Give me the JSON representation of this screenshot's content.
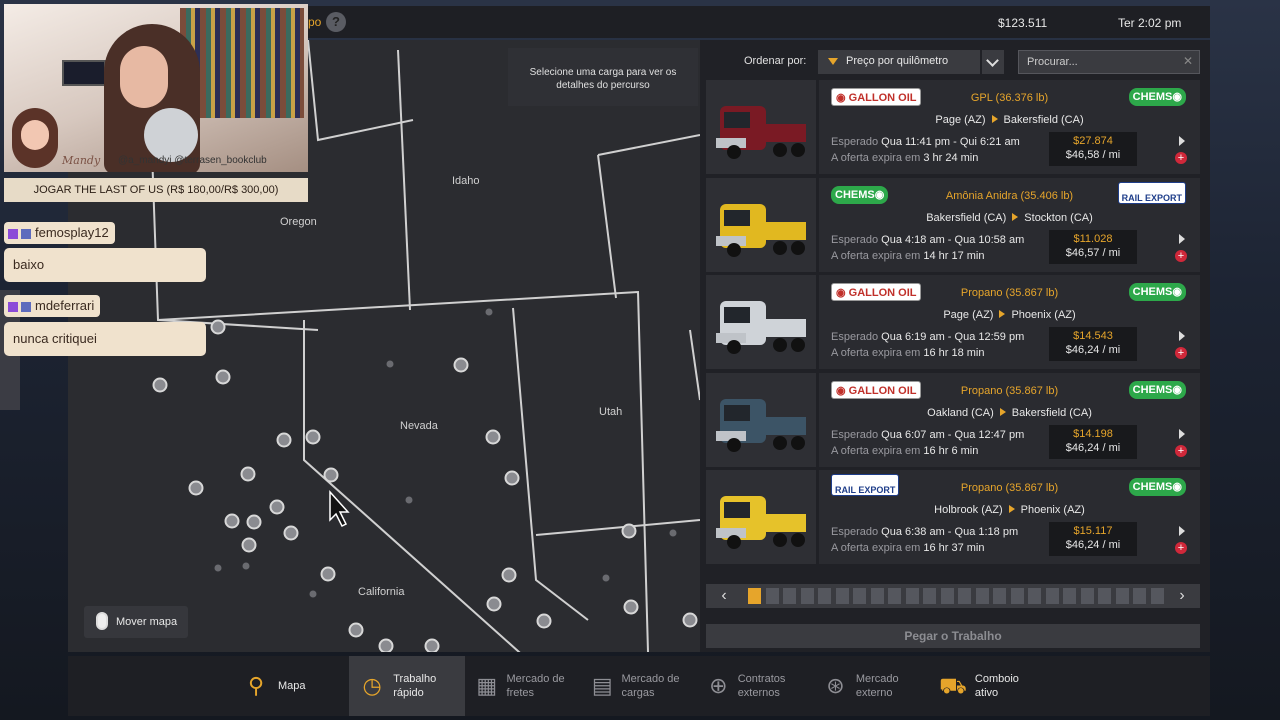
{
  "topbar": {
    "tab_stub": "po",
    "help_icon": "?",
    "money": "$123.511",
    "clock": "Ter 2:02 pm"
  },
  "map": {
    "hint": "Selecione uma carga para ver os detalhes do percurso",
    "states": {
      "oregon": "Oregon",
      "idaho": "Idaho",
      "nevada": "Nevada",
      "utah": "Utah",
      "california": "California"
    },
    "move_button": "Mover mapa"
  },
  "jobs_panel": {
    "sort_label": "Ordenar por:",
    "sort_value": "Preço por quilômetro",
    "search_placeholder": "Procurar...",
    "expected_label": "Esperado",
    "offer_label": "A oferta expira em",
    "jobs": [
      {
        "from_logo": "GALLON OIL",
        "to_logo": "CHEMSO",
        "cargo": "GPL (36.376 lb)",
        "origin": "Page (AZ)",
        "destination": "Bakersfield (CA)",
        "expected": "Qua 11:41 pm - Qui 6:21 am",
        "expires": "3 hr 24 min",
        "price": "$27.874",
        "per_mile": "$46,58 / mi",
        "truck_color": "#7a1a24"
      },
      {
        "from_logo": "CHEMSO",
        "to_logo": "RAIL EXPORT",
        "cargo": "Amônia Anidra (35.406 lb)",
        "origin": "Bakersfield (CA)",
        "destination": "Stockton (CA)",
        "expected": "Qua 4:18 am - Qua 10:58 am",
        "expires": "14 hr 17 min",
        "price": "$11.028",
        "per_mile": "$46,57 / mi",
        "truck_color": "#e1b820"
      },
      {
        "from_logo": "GALLON OIL",
        "to_logo": "CHEMSO",
        "cargo": "Propano (35.867 lb)",
        "origin": "Page (AZ)",
        "destination": "Phoenix (AZ)",
        "expected": "Qua 6:19 am - Qua 12:59 pm",
        "expires": "16 hr 18 min",
        "price": "$14.543",
        "per_mile": "$46,24 / mi",
        "truck_color": "#cfd3d8"
      },
      {
        "from_logo": "GALLON OIL",
        "to_logo": "CHEMSO",
        "cargo": "Propano (35.867 lb)",
        "origin": "Oakland (CA)",
        "destination": "Bakersfield (CA)",
        "expected": "Qua 6:07 am - Qua 12:47 pm",
        "expires": "16 hr 6 min",
        "price": "$14.198",
        "per_mile": "$46,24 / mi",
        "truck_color": "#3c5466"
      },
      {
        "from_logo": "RAIL EXPORT",
        "to_logo": "CHEMSO",
        "cargo": "Propano (35.867 lb)",
        "origin": "Holbrook (AZ)",
        "destination": "Phoenix (AZ)",
        "expected": "Qua 6:38 am - Qua 1:18 pm",
        "expires": "16 hr 37 min",
        "price": "$15.117",
        "per_mile": "$46,24 / mi",
        "truck_color": "#e6c22a"
      }
    ],
    "pager": {
      "current": 1,
      "total": 24
    },
    "take_job": "Pegar o Trabalho"
  },
  "bottom_nav": [
    {
      "label": "Mapa",
      "icon": "map-icon"
    },
    {
      "label": "Trabalho rápido",
      "icon": "clock-icon"
    },
    {
      "label": "Mercado de fretes",
      "icon": "boxes-icon"
    },
    {
      "label": "Mercado de cargas",
      "icon": "cargo-icon"
    },
    {
      "label": "Contratos externos",
      "icon": "globe-icon"
    },
    {
      "label": "Mercado externo",
      "icon": "globe-cargo-icon"
    },
    {
      "label": "Comboio ativo",
      "icon": "convoy-icon"
    }
  ],
  "stream_overlay": {
    "signature": "Mandy",
    "handles": "@a_mandyi @terrasen_bookclub",
    "goal": "JOGAR THE LAST OF US (R$ 180,00/R$ 300,00)",
    "chat": [
      {
        "user": "femosplay12",
        "message": "baixo"
      },
      {
        "user": "mdeferrari",
        "message": "nunca critiquei"
      }
    ]
  },
  "colors": {
    "accent": "#e6a52b",
    "panel": "#202126",
    "map_bg": "#2b2c30"
  }
}
